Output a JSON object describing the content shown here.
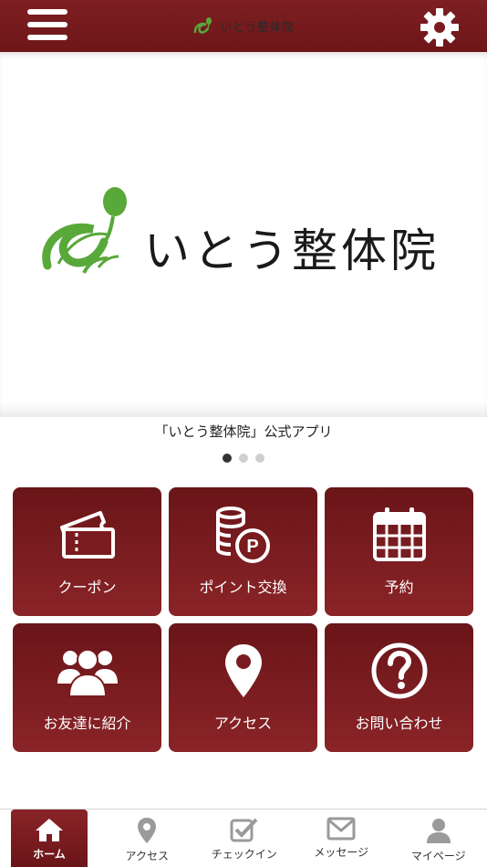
{
  "header": {
    "title": "いとう整体院",
    "menu_icon": "hamburger-menu-icon",
    "settings_icon": "gear-icon"
  },
  "hero": {
    "title": "いとう整体院"
  },
  "caption": "「いとう整体院」公式アプリ",
  "carousel": {
    "total": 3,
    "active": 1
  },
  "tiles": [
    {
      "label": "クーポン",
      "icon": "ticket-icon"
    },
    {
      "label": "ポイント交換",
      "icon": "coins-points-icon"
    },
    {
      "label": "予約",
      "icon": "calendar-icon"
    },
    {
      "label": "お友達に紹介",
      "icon": "users-group-icon"
    },
    {
      "label": "アクセス",
      "icon": "map-pin-icon"
    },
    {
      "label": "お問い合わせ",
      "icon": "question-circle-icon"
    }
  ],
  "tabbar": [
    {
      "label": "ホーム",
      "icon": "home-icon",
      "active": true
    },
    {
      "label": "アクセス",
      "icon": "map-pin-icon",
      "active": false
    },
    {
      "label": "チェックイン",
      "icon": "checkin-icon",
      "active": false
    },
    {
      "label": "メッセージ",
      "icon": "envelope-icon",
      "active": false
    },
    {
      "label": "マイページ",
      "icon": "user-icon",
      "active": false
    }
  ],
  "colors": {
    "brand": "#7a1c1f",
    "logo_green": "#58a83a",
    "tab_icon": "#9a9a9a"
  }
}
